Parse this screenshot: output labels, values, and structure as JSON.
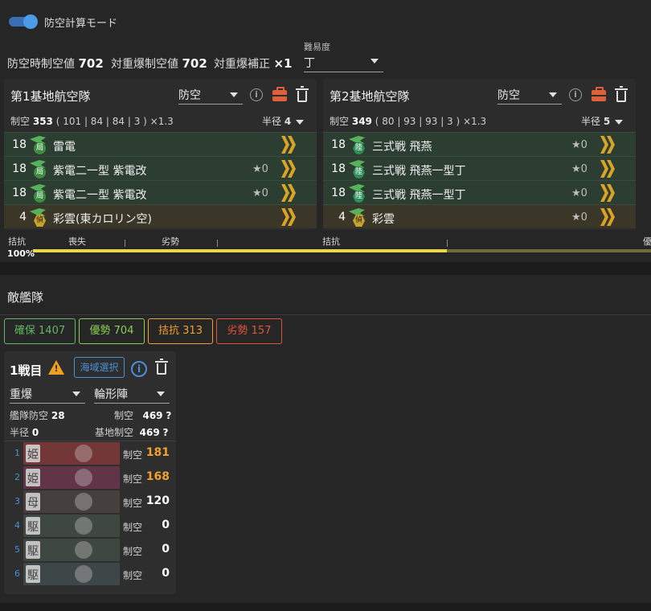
{
  "header": {
    "toggle_label": "防空計算モード",
    "stats": [
      {
        "label": "防空時制空値",
        "value": "702"
      },
      {
        "label": "対重爆制空値",
        "value": "702"
      },
      {
        "label": "対重爆補正",
        "value": "×1"
      }
    ],
    "difficulty": {
      "label": "難易度",
      "value": "丁"
    }
  },
  "land_bases": [
    {
      "title": "第1基地航空隊",
      "mode": "防空",
      "summary_label": "制空",
      "summary_value": "353",
      "summary_detail": "( 101 | 84 | 84 | 3 ) ×1.3",
      "radius_label": "半径",
      "radius_value": "4",
      "slots": [
        {
          "count": "18",
          "badge": "局",
          "name": "雷電",
          "proficiency": ""
        },
        {
          "count": "18",
          "badge": "局",
          "name": "紫電二一型 紫電改",
          "proficiency": "★0"
        },
        {
          "count": "18",
          "badge": "局",
          "name": "紫電二一型 紫電改",
          "proficiency": "★0"
        },
        {
          "count": "4",
          "badge": "偵",
          "name": "彩雲(東カロリン空)",
          "proficiency": ""
        }
      ]
    },
    {
      "title": "第2基地航空隊",
      "mode": "防空",
      "summary_label": "制空",
      "summary_value": "349",
      "summary_detail": "( 80 | 93 | 93 | 3 ) ×1.3",
      "radius_label": "半径",
      "radius_value": "5",
      "slots": [
        {
          "count": "18",
          "badge": "陸",
          "name": "三式戦 飛燕",
          "proficiency": "★0"
        },
        {
          "count": "18",
          "badge": "陸",
          "name": "三式戦 飛燕一型丁",
          "proficiency": "★0"
        },
        {
          "count": "18",
          "badge": "陸",
          "name": "三式戦 飛燕一型丁",
          "proficiency": "★0"
        },
        {
          "count": "4",
          "badge": "偵",
          "name": "彩雲",
          "proficiency": "★0"
        }
      ]
    }
  ],
  "gauge": {
    "labels": [
      "拮抗",
      "喪失",
      "劣勢",
      "拮抗",
      "優"
    ],
    "percent_label": "100%",
    "fill_fraction": 0.67
  },
  "enemy": {
    "title": "敵艦隊",
    "chips": [
      {
        "label": "確保 1407",
        "color": "#5fb865"
      },
      {
        "label": "優勢 704",
        "color": "#8ccc52"
      },
      {
        "label": "拮抗 313",
        "color": "#f0a030"
      },
      {
        "label": "劣勢 157",
        "color": "#e0553a"
      }
    ],
    "battle": {
      "title": "1戦目",
      "warning_icon": "warning-icon",
      "sea_button": "海域選択",
      "formation_type": "重爆",
      "formation": "輪形陣",
      "fleet_aa_label": "艦隊防空",
      "fleet_aa_value": "28",
      "air_label": "制空",
      "air_value": "469",
      "radius_label": "半径",
      "radius_value": "0",
      "base_air_label": "基地制空",
      "base_air_value": "469",
      "unknown_mark": "?",
      "ships": [
        {
          "index": "1",
          "label": "制空",
          "value": "181",
          "value_color": "#f0a030",
          "tint": "#8a1e1e",
          "glyph": "姫"
        },
        {
          "index": "2",
          "label": "制空",
          "value": "168",
          "value_color": "#f0a030",
          "tint": "#6a1a3a",
          "glyph": "姫"
        },
        {
          "index": "3",
          "label": "制空",
          "value": "120",
          "value_color": "#ffffff",
          "tint": "#3a2a2a",
          "glyph": "母"
        },
        {
          "index": "4",
          "label": "制空",
          "value": "0",
          "value_color": "#ffffff",
          "tint": "#2a3a2e",
          "glyph": "駆"
        },
        {
          "index": "5",
          "label": "制空",
          "value": "0",
          "value_color": "#ffffff",
          "tint": "#2a3a2e",
          "glyph": "駆"
        },
        {
          "index": "6",
          "label": "制空",
          "value": "0",
          "value_color": "#ffffff",
          "tint": "#2a3a3a",
          "glyph": "駆"
        }
      ]
    }
  }
}
